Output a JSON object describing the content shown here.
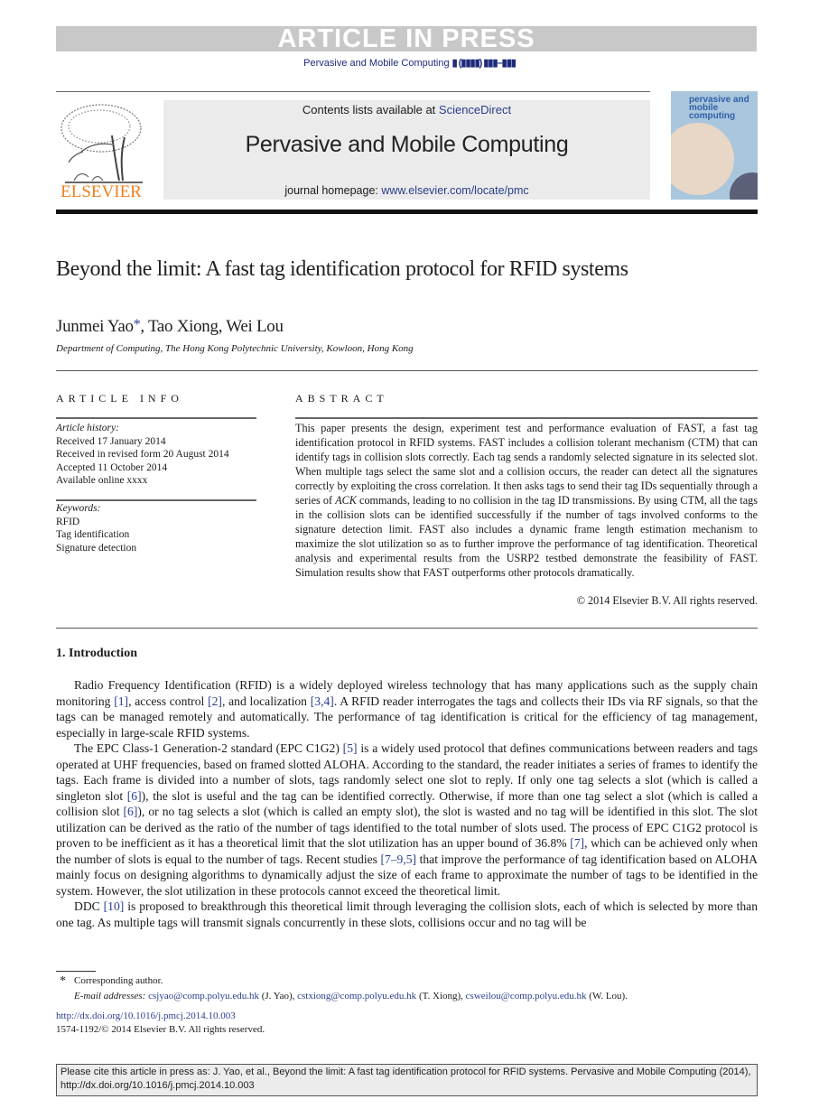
{
  "banner": {
    "text": "ARTICLE IN PRESS"
  },
  "journal_ref": {
    "name": "Pervasive and Mobile Computing",
    "volume_placeholder": "▮ (▮▮▮▮) ▮▮▮–▮▮▮"
  },
  "header": {
    "publisher_logo_text": "ELSEVIER",
    "contents_prefix": "Contents lists available at ",
    "contents_link": "ScienceDirect",
    "journal_title": "Pervasive and Mobile Computing",
    "homepage_prefix": "journal homepage: ",
    "homepage_link": "www.elsevier.com/locate/pmc",
    "cover_title": "pervasive and mobile computing"
  },
  "colors": {
    "link": "#2a3e8c",
    "elsevier_orange": "#f07f1e",
    "banner_gray": "#c8c8c8"
  },
  "article": {
    "title": "Beyond the limit: A fast tag identification protocol for RFID systems",
    "authors": [
      {
        "name": "Junmei Yao",
        "corresponding": "*"
      },
      {
        "name": ", Tao Xiong, Wei Lou"
      }
    ],
    "affiliation": "Department of Computing, The Hong Kong Polytechnic University, Kowloon, Hong Kong"
  },
  "article_info": {
    "heading": "ARTICLE INFO",
    "history_label": "Article history:",
    "history": [
      "Received 17 January 2014",
      "Received in revised form 20 August 2014",
      "Accepted 11 October 2014",
      "Available online xxxx"
    ],
    "keywords_label": "Keywords:",
    "keywords": [
      "RFID",
      "Tag identification",
      "Signature detection"
    ]
  },
  "abstract": {
    "heading": "ABSTRACT",
    "text_1": "This paper presents the design, experiment test and performance evaluation of FAST, a fast tag identification protocol in RFID systems. FAST includes a collision tolerant mechanism (CTM) that can identify tags in collision slots correctly. Each tag sends a randomly selected signature in its selected slot. When multiple tags select the same slot and a collision occurs, the reader can detect all the signatures correctly by exploiting the cross correlation. It then asks tags to send their tag IDs sequentially through a series of ",
    "text_italic": "ACK",
    "text_2": " commands, leading to no collision in the tag ID transmissions. By using CTM, all the tags in the collision slots can be identified successfully if the number of tags involved conforms to the signature detection limit. FAST also includes a dynamic frame length estimation mechanism to maximize the slot utilization so as to further improve the performance of tag identification. Theoretical analysis and experimental results from the USRP2 testbed demonstrate the feasibility of FAST. Simulation results show that FAST outperforms other protocols dramatically.",
    "copyright": "© 2014 Elsevier B.V. All rights reserved."
  },
  "section": {
    "heading": "1. Introduction",
    "p1": {
      "a": "Radio Frequency Identification (RFID) is a widely deployed wireless technology that has many applications such as the supply chain monitoring ",
      "r1": "[1]",
      "b": ", access control ",
      "r2": "[2]",
      "c": ", and localization ",
      "r3": "[3,4]",
      "d": ". A RFID reader interrogates the tags and collects their IDs via RF signals, so that the tags can be managed remotely and automatically. The performance of tag identification is critical for the efficiency of tag management, especially in large-scale RFID systems."
    },
    "p2": {
      "a": "The EPC Class-1 Generation-2 standard (EPC C1G2) ",
      "r1": "[5]",
      "b": " is a widely used protocol that defines communications between readers and tags operated at UHF frequencies, based on framed slotted ALOHA. According to the standard, the reader initiates a series of frames to identify the tags. Each frame is divided into a number of slots, tags randomly select one slot to reply. If only one tag selects a slot (which is called a singleton slot ",
      "r2": "[6]",
      "c": "), the slot is useful and the tag can be identified correctly. Otherwise, if more than one tag select a slot (which is called a collision slot ",
      "r3": "[6]",
      "d": "), or no tag selects a slot (which is called an empty slot), the slot is wasted and no tag will be identified in this slot. The slot utilization can be derived as the ratio of the number of tags identified to the total number of slots used. The process of EPC C1G2 protocol is proven to be inefficient as it has a theoretical limit that the slot utilization has an upper bound of 36.8% ",
      "r4": "[7]",
      "e": ", which can be achieved only when the number of slots is equal to the number of tags. Recent studies ",
      "r5": "[7–9,5]",
      "f": " that improve the performance of tag identification based on ALOHA mainly focus on designing algorithms to dynamically adjust the size of each frame to approximate the number of tags to be identified in the system. However, the slot utilization in these protocols cannot exceed the theoretical limit."
    },
    "p3": {
      "a": "DDC ",
      "r1": "[10]",
      "b": " is proposed to breakthrough this theoretical limit through leveraging the collision slots, each of which is selected by more than one tag. As multiple tags will transmit signals concurrently in these slots, collisions occur and no tag will be"
    }
  },
  "footnotes": {
    "star": "*",
    "corresponding": "Corresponding author.",
    "email_label": "E-mail addresses: ",
    "emails": [
      {
        "addr": "csjyao@comp.polyu.edu.hk",
        "who": " (J. Yao), "
      },
      {
        "addr": "cstxiong@comp.polyu.edu.hk",
        "who": " (T. Xiong), "
      },
      {
        "addr": "csweilou@comp.polyu.edu.hk",
        "who": " (W. Lou)."
      }
    ],
    "doi": "http://dx.doi.org/10.1016/j.pmcj.2014.10.003",
    "issn": "1574-1192/© 2014 Elsevier B.V. All rights reserved."
  },
  "citation_box": {
    "text": "Please cite this article in press as: J. Yao, et al., Beyond the limit: A fast tag identification protocol for RFID systems. Pervasive and Mobile Computing (2014), http://dx.doi.org/10.1016/j.pmcj.2014.10.003"
  }
}
